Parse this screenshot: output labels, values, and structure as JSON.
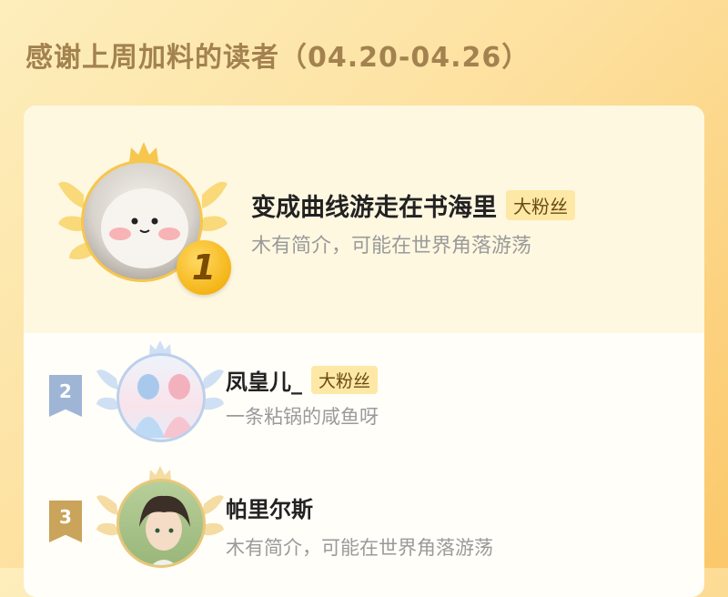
{
  "header": {
    "title": "感谢上周加料的读者（04.20-04.26）"
  },
  "readers": [
    {
      "rank": "1",
      "name": "变成曲线游走在书海里",
      "badge": "大粉丝",
      "bio": "木有简介，可能在世界角落游荡"
    },
    {
      "rank": "2",
      "name": "凤皇儿_",
      "badge": "大粉丝",
      "bio": "一条粘锅的咸鱼呀"
    },
    {
      "rank": "3",
      "name": "帕里尔斯",
      "badge": "",
      "bio": "木有简介，可能在世界角落游荡"
    }
  ],
  "colors": {
    "gold": "#f5b517",
    "silver_ribbon": "#9fb5d6",
    "bronze_ribbon": "#c9a45a"
  },
  "icons": [
    "crown-icon",
    "laurel-icon"
  ]
}
